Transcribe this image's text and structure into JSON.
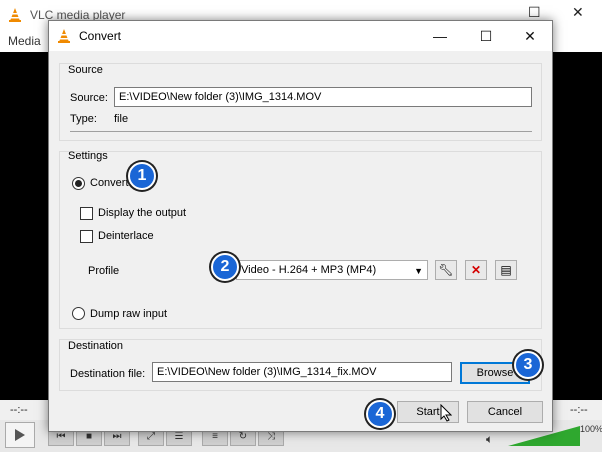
{
  "vlc": {
    "title": "VLC media player",
    "menu_media": "Media",
    "time_left": "--:--",
    "time_right": "--:--",
    "volume": "100%"
  },
  "dialog": {
    "title": "Convert",
    "source": {
      "group_title": "Source",
      "source_label": "Source:",
      "source_value": "E:\\VIDEO\\New folder (3)\\IMG_1314.MOV",
      "type_label": "Type:",
      "type_value": "file"
    },
    "settings": {
      "group_title": "Settings",
      "convert_label": "Convert",
      "display_output_label": "Display the output",
      "deinterlace_label": "Deinterlace",
      "profile_label": "Profile",
      "profile_value": "Video - H.264 + MP3 (MP4)",
      "dump_raw_label": "Dump raw input"
    },
    "destination": {
      "group_title": "Destination",
      "file_label": "Destination file:",
      "file_value": "E:\\VIDEO\\New folder (3)\\IMG_1314_fix.MOV",
      "browse_label": "Browse"
    },
    "start_label": "Start",
    "cancel_label": "Cancel"
  },
  "callouts": [
    "1",
    "2",
    "3",
    "4"
  ],
  "colors": {
    "callout_blue": "#1a66d6",
    "vlc_orange": "#f08a00",
    "volume_green": "#2fa82f",
    "delete_red": "#d40000"
  }
}
